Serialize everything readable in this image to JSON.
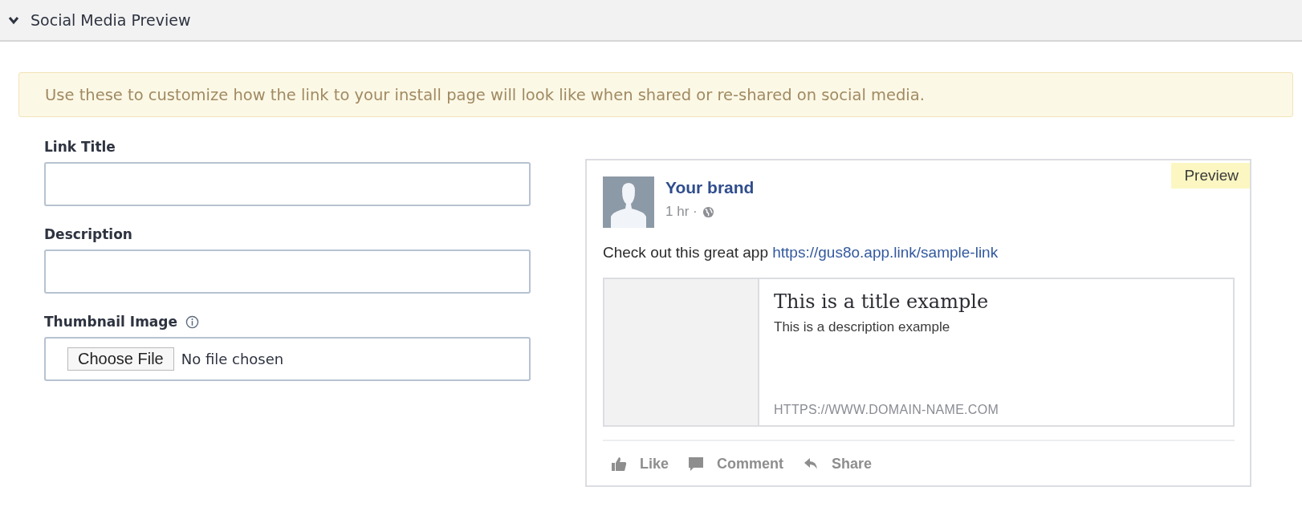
{
  "section": {
    "title": "Social Media Preview",
    "expanded": true
  },
  "notice": "Use these to customize how the link to your install page will look like when shared or re-shared on social media.",
  "fields": [
    {
      "kind": "text",
      "label": "Link Title",
      "info": false
    },
    {
      "kind": "text",
      "label": "Description",
      "info": false
    },
    {
      "kind": "file",
      "label": "Thumbnail Image",
      "info": true,
      "button": "Choose File",
      "status": "No file chosen"
    }
  ],
  "preview": {
    "badge": "Preview",
    "brand": "Your brand",
    "time": "1 hr ·",
    "message": "Check out this great app",
    "link": "https://gus8o.app.link/sample-link",
    "card": {
      "title": "This is a title example",
      "description": "This is a description example",
      "domain": "HTTPS://WWW.DOMAIN-NAME.COM"
    },
    "actions": [
      {
        "kind": "like",
        "label": "Like"
      },
      {
        "kind": "comment",
        "label": "Comment"
      },
      {
        "kind": "share",
        "label": "Share"
      }
    ]
  }
}
